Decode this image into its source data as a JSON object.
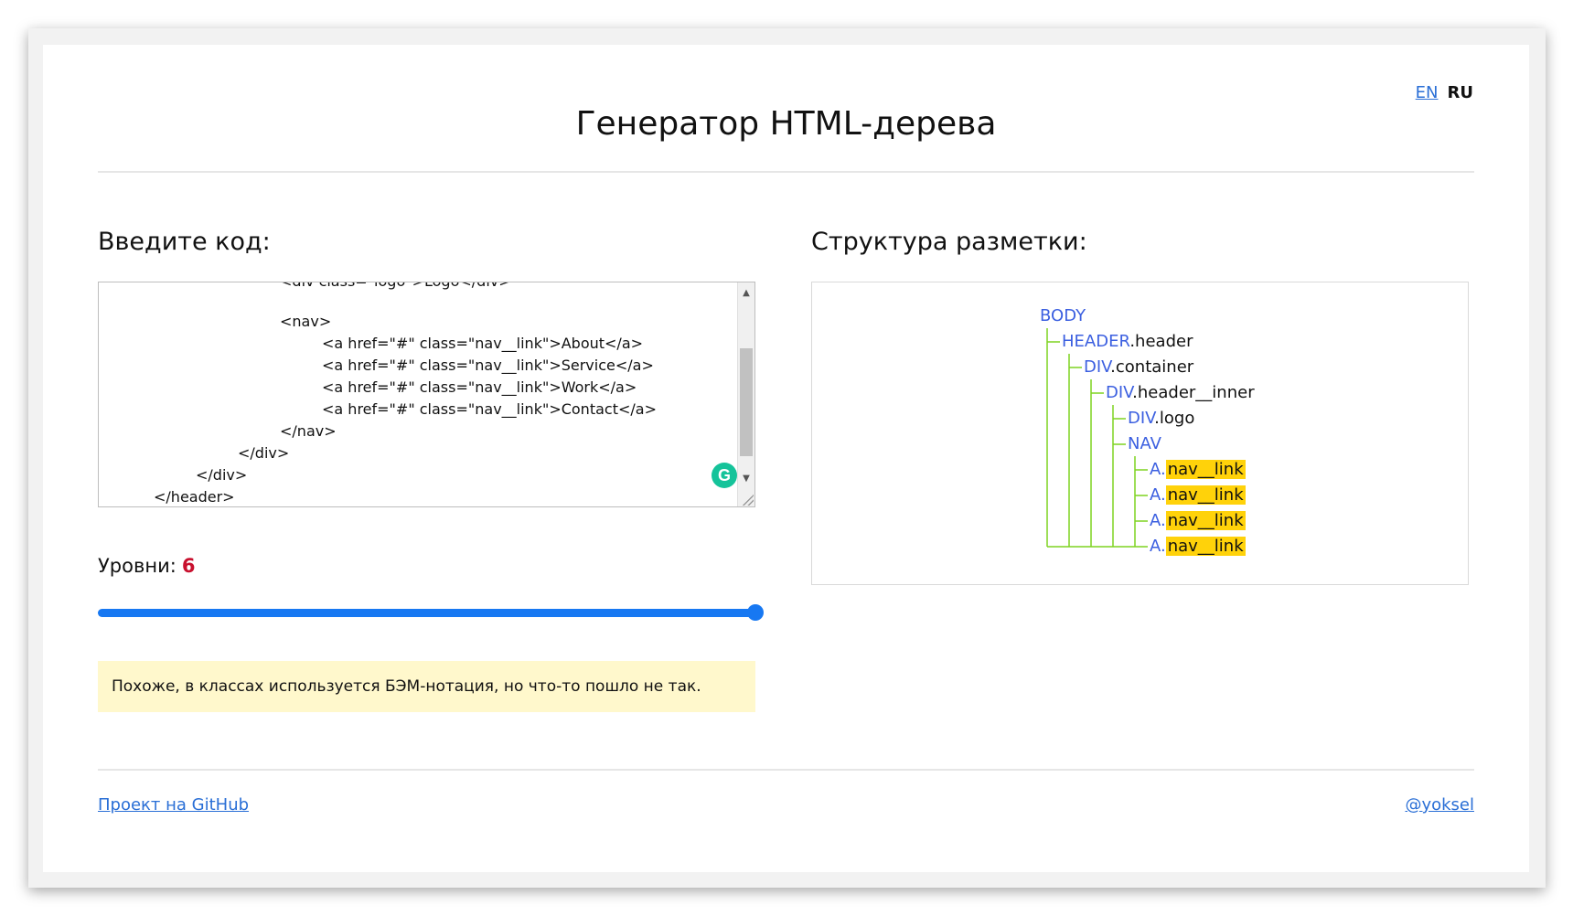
{
  "language_switch": {
    "en": "EN",
    "ru": "RU"
  },
  "title": "Генератор HTML-дерева",
  "input_label": "Введите код:",
  "output_label": "Структура разметки:",
  "code_lines": [
    {
      "text": "<div class=\"logo\">Logo</div>",
      "indent": 4
    },
    {
      "text": "<nav>",
      "indent": 4
    },
    {
      "text": "<a href=\"#\" class=\"nav__link\">About</a>",
      "indent": 5
    },
    {
      "text": "<a href=\"#\" class=\"nav__link\">Service</a>",
      "indent": 5
    },
    {
      "text": "<a href=\"#\" class=\"nav__link\">Work</a>",
      "indent": 5
    },
    {
      "text": "<a href=\"#\" class=\"nav__link\">Contact</a>",
      "indent": 5
    },
    {
      "text": "</nav>",
      "indent": 4
    },
    {
      "text": "</div>",
      "indent": 3
    },
    {
      "text": "</div>",
      "indent": 2
    },
    {
      "text": "</header>",
      "indent": 1
    }
  ],
  "grammarly_icon": "G",
  "levels": {
    "label": "Уровни:",
    "value": "6",
    "fraction": 1.0
  },
  "warning": "Похоже, в классах используется БЭМ-нотация, но что-то пошло не так.",
  "tree": [
    {
      "tag": "BODY",
      "cls": "",
      "depth": 0,
      "highlight": false
    },
    {
      "tag": "HEADER",
      "cls": ".header",
      "depth": 1,
      "highlight": false
    },
    {
      "tag": "DIV",
      "cls": ".container",
      "depth": 2,
      "highlight": false
    },
    {
      "tag": "DIV",
      "cls": ".header__inner",
      "depth": 3,
      "highlight": false
    },
    {
      "tag": "DIV",
      "cls": ".logo",
      "depth": 4,
      "highlight": false
    },
    {
      "tag": "NAV",
      "cls": "",
      "depth": 4,
      "highlight": false
    },
    {
      "tag": "A",
      "cls": "nav__link",
      "depth": 5,
      "highlight": true
    },
    {
      "tag": "A",
      "cls": "nav__link",
      "depth": 5,
      "highlight": true
    },
    {
      "tag": "A",
      "cls": "nav__link",
      "depth": 5,
      "highlight": true
    },
    {
      "tag": "A",
      "cls": "nav__link",
      "depth": 5,
      "highlight": true
    }
  ],
  "colors": {
    "accent": "#1778f2",
    "tree_lines": "#7ed321",
    "highlight": "#ffd20a",
    "warning_bg": "#fff8cc",
    "level_value": "#c8102e"
  },
  "footer": {
    "github": "Проект на GitHub",
    "author": "@yoksel"
  }
}
